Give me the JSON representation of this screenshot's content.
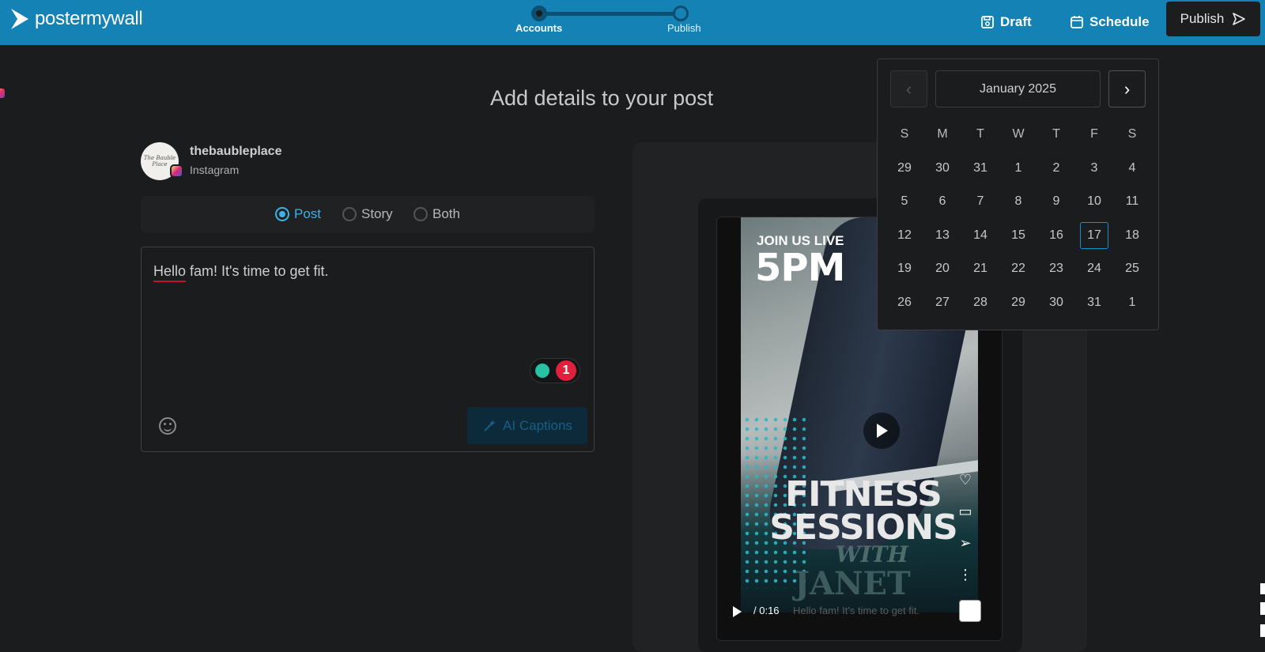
{
  "header": {
    "logo_text": "postermywall",
    "steps": [
      {
        "label": "Accounts",
        "state": "done"
      },
      {
        "label": "Publish",
        "state": "todo"
      }
    ],
    "draft_label": "Draft",
    "schedule_label": "Schedule",
    "publish_label": "Publish"
  },
  "page_title": "Add details to your post",
  "account": {
    "name": "thebaubleplace",
    "platform": "Instagram",
    "avatar_text": "The Bauble Place"
  },
  "post_types": {
    "options": [
      "Post",
      "Story",
      "Both"
    ],
    "selected": "Post"
  },
  "caption": {
    "text_underlined": "Hello",
    "text_rest": " fam! It's time to get fit.",
    "hint_count": "1",
    "ai_label": "AI Captions"
  },
  "preview": {
    "line1": "JOIN US LIVE",
    "line2": "5PM",
    "line3": "FITNESS SESSIONS",
    "line4": "WITH",
    "line5": "JANET",
    "time": "/ 0:16",
    "caption_overlay": "Hello fam! It's time to get fit."
  },
  "calendar": {
    "month_label": "January 2025",
    "weekdays": [
      "S",
      "M",
      "T",
      "W",
      "T",
      "F",
      "S"
    ],
    "weeks": [
      [
        "29",
        "30",
        "31",
        "1",
        "2",
        "3",
        "4"
      ],
      [
        "5",
        "6",
        "7",
        "8",
        "9",
        "10",
        "11"
      ],
      [
        "12",
        "13",
        "14",
        "15",
        "16",
        "17",
        "18"
      ],
      [
        "19",
        "20",
        "21",
        "22",
        "23",
        "24",
        "25"
      ],
      [
        "26",
        "27",
        "28",
        "29",
        "30",
        "31",
        "1"
      ]
    ],
    "selected": "17"
  },
  "colors": {
    "header_bg": "#1482b4",
    "accent": "#3db2e8",
    "badge_red": "#e0203d"
  }
}
